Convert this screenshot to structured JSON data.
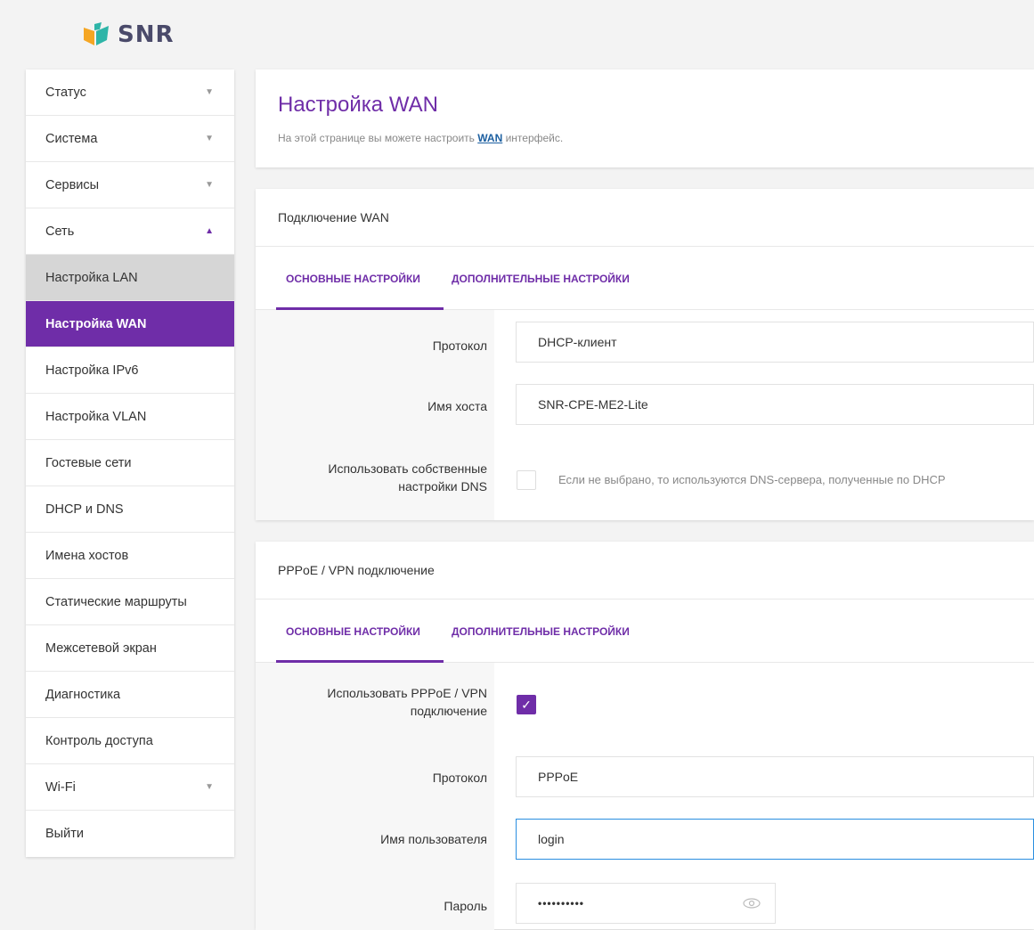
{
  "brand": {
    "logo_text": "SNR",
    "logo_colors": [
      "#f5a623",
      "#2eb5a8"
    ]
  },
  "sidebar": {
    "items": [
      {
        "label": "Статус",
        "arrow": "down"
      },
      {
        "label": "Система",
        "arrow": "down"
      },
      {
        "label": "Сервисы",
        "arrow": "down"
      },
      {
        "label": "Сеть",
        "arrow": "up"
      },
      {
        "label": "Настройка LAN"
      },
      {
        "label": "Настройка WAN"
      },
      {
        "label": "Настройка IPv6"
      },
      {
        "label": "Настройка VLAN"
      },
      {
        "label": "Гостевые сети"
      },
      {
        "label": "DHCP и DNS"
      },
      {
        "label": "Имена хостов"
      },
      {
        "label": "Статические маршруты"
      },
      {
        "label": "Межсетевой экран"
      },
      {
        "label": "Диагностика"
      },
      {
        "label": "Контроль доступа"
      },
      {
        "label": "Wi-Fi",
        "arrow": "down"
      },
      {
        "label": "Выйти"
      }
    ]
  },
  "header": {
    "title": "Настройка WAN",
    "desc_before": "На этой странице вы можете настроить ",
    "desc_link": "WAN",
    "desc_after": " интерфейс."
  },
  "wan": {
    "title": "Подключение WAN",
    "tab_basic": "ОСНОВНЫЕ НАСТРОЙКИ",
    "tab_advanced": "ДОПОЛНИТЕЛЬНЫЕ НАСТРОЙКИ",
    "protocol_label": "Протокол",
    "protocol_value": "DHCP-клиент",
    "hostname_label": "Имя хоста",
    "hostname_value": "SNR-CPE-ME2-Lite",
    "dns_label_1": "Использовать собственные",
    "dns_label_2": "настройки DNS",
    "dns_hint": "Если не выбрано, то используются DNS-сервера, полученные по DHCP",
    "dns_checked": false
  },
  "pppoe": {
    "title": "PPPoE / VPN подключение",
    "tab_basic": "ОСНОВНЫЕ НАСТРОЙКИ",
    "tab_advanced": "ДОПОЛНИТЕЛЬНЫЕ НАСТРОЙКИ",
    "use_label_1": "Использовать PPPoE / VPN",
    "use_label_2": "подключение",
    "use_checked": true,
    "check_glyph": "✓",
    "protocol_label": "Протокол",
    "protocol_value": "PPPoE",
    "user_label": "Имя пользователя",
    "user_value": "login",
    "pass_label": "Пароль",
    "pass_value": "••••••••••"
  },
  "colors": {
    "accent": "#6f2da8",
    "link": "#1c5fa0",
    "focus": "#2a8ee0"
  }
}
